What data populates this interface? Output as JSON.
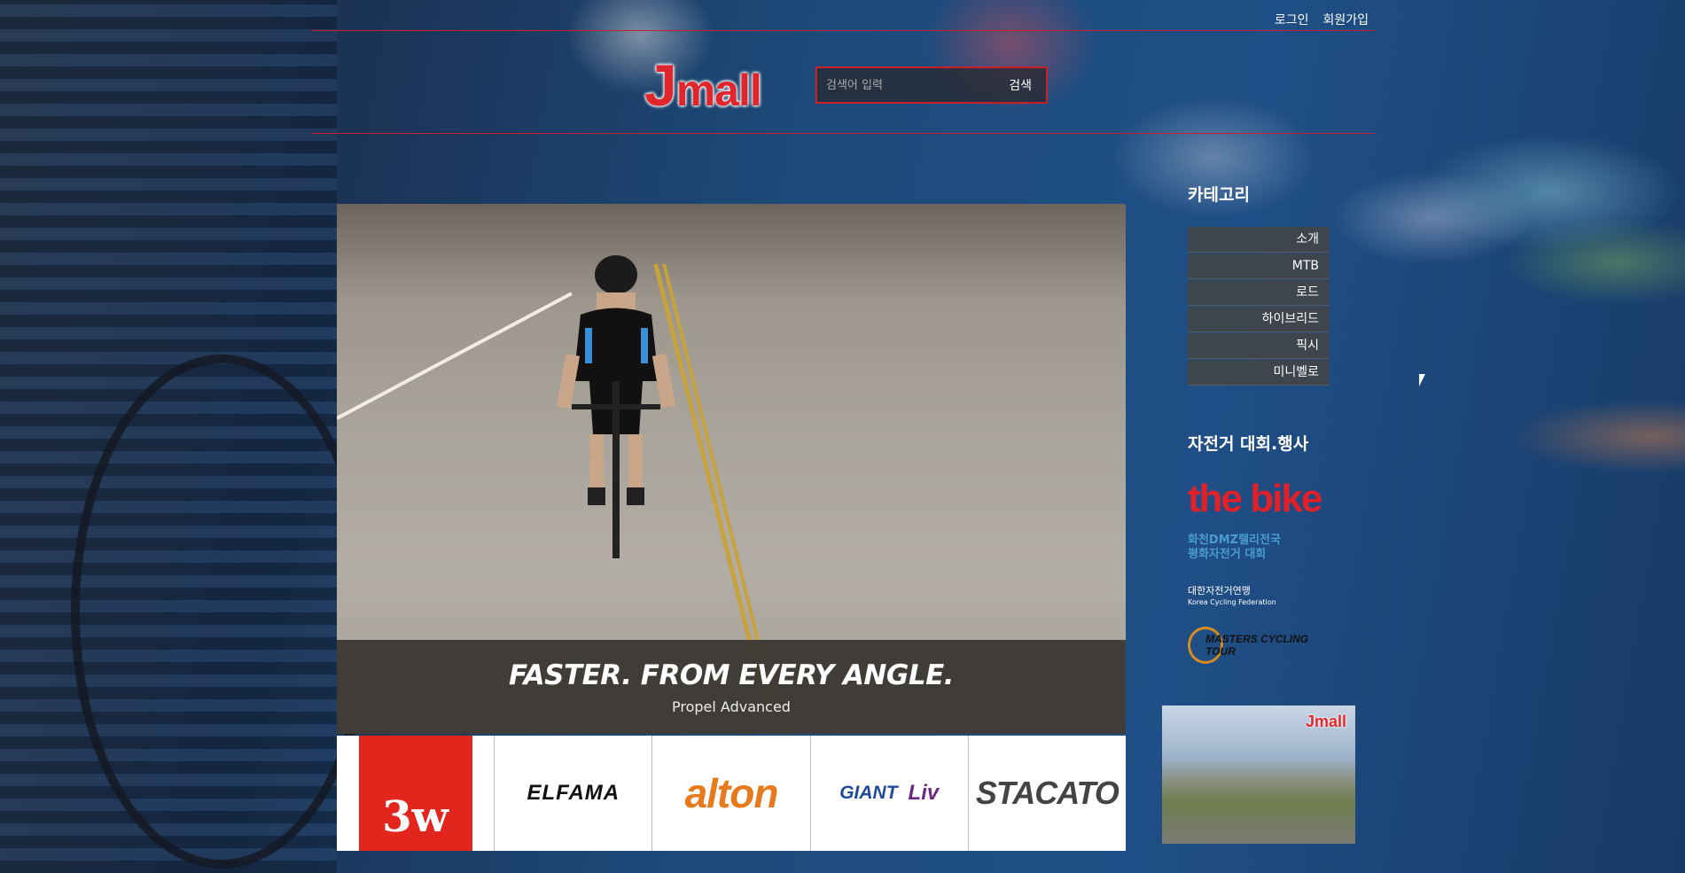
{
  "header": {
    "login_label": "로그인",
    "signup_label": "회원가입",
    "logo_text": "mall",
    "logo_initial": "J",
    "search_placeholder": "검색어 입력",
    "search_button": "검색"
  },
  "hero": {
    "title": "FASTER. FROM EVERY ANGLE.",
    "subtitle": "Propel Advanced"
  },
  "brands": {
    "items": [
      "3w",
      "ELFAMA",
      "alton",
      "GIANT",
      "Liv",
      "STACATO"
    ]
  },
  "sidebar": {
    "category_heading": "카테고리",
    "categories": [
      "소개",
      "MTB",
      "로드",
      "하이브리드",
      "픽시",
      "미니벨로"
    ],
    "events_heading": "자전거 대회.행사",
    "events": {
      "bike": "the bike",
      "dmz_line1": "화천DMZ랠리전국",
      "dmz_line2": "평화자전거 대회",
      "kcf_line1": "대한자전거연맹",
      "kcf_line2": "Korea Cycling Federation",
      "masters": "MASTERS CYCLING TOUR"
    },
    "video_logo": "Jmall"
  },
  "colors": {
    "accent": "#c8202a",
    "logo": "#e0262c"
  }
}
